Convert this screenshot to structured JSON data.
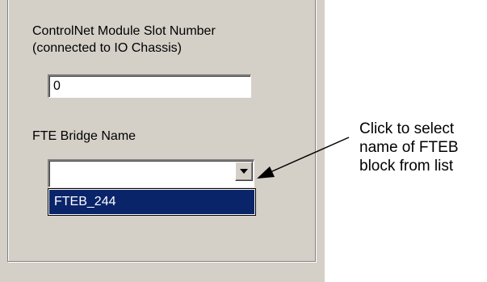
{
  "form": {
    "slot_label_line1": "ControlNet Module Slot Number",
    "slot_label_line2": "(connected to IO Chassis)",
    "slot_value": "0",
    "bridge_label": "FTE Bridge Name",
    "bridge_value": "",
    "bridge_options": [
      "FTEB_244"
    ]
  },
  "callout": {
    "line1": "Click to select",
    "line2": "name of FTEB",
    "line3": "block from list"
  },
  "icons": {
    "dropdown": "chevron-down-icon",
    "arrow": "pointer-arrow-icon"
  },
  "colors": {
    "panel_bg": "#d4d0c8",
    "selection_bg": "#0a246a",
    "selection_text": "#ffffff"
  }
}
